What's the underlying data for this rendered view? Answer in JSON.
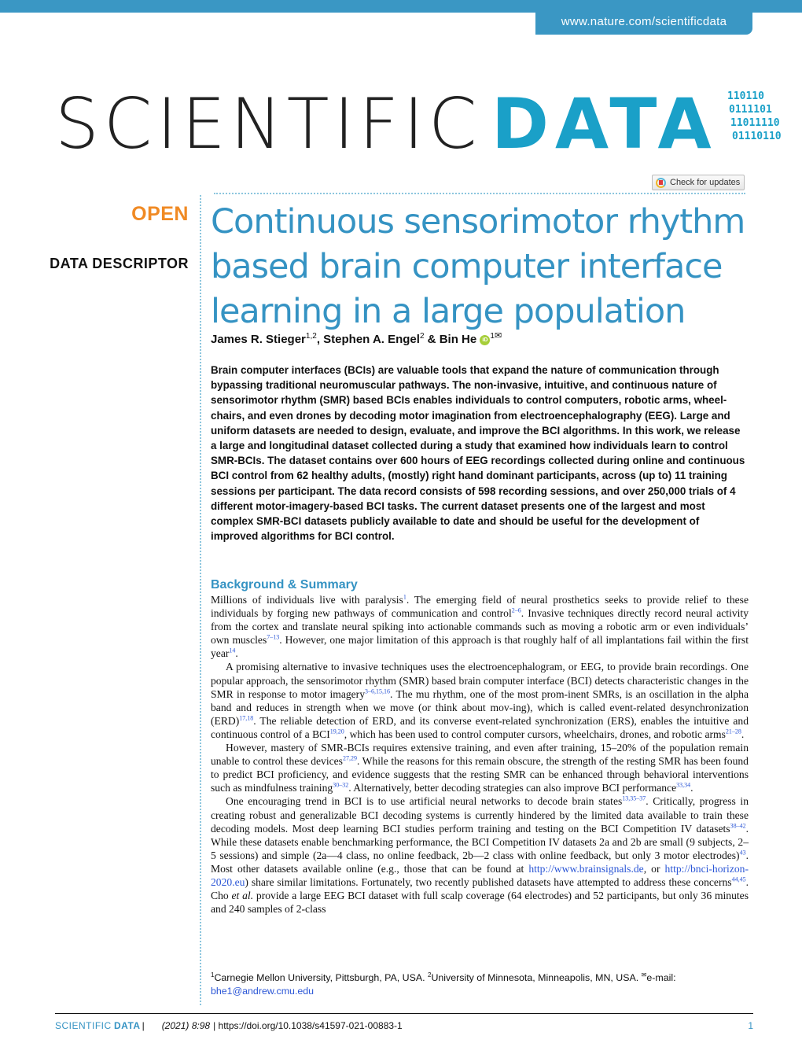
{
  "header": {
    "url": "www.nature.com/scientificdata"
  },
  "logo": {
    "word1": "SCIENTIFIC",
    "word2": "DATA",
    "binary": [
      "110110",
      "0111101",
      "11011110",
      "01110110"
    ]
  },
  "check_updates": {
    "label": "Check for updates",
    "icon": "crossmark-icon"
  },
  "badges": {
    "open": "OPEN",
    "type": "DATA DESCRIPTOR"
  },
  "colors": {
    "accent": "#3593c3",
    "open": "#f08a24",
    "link": "#2b56d6",
    "orcid": "#a6ce39"
  },
  "article": {
    "title": "Continuous sensorimotor rhythm based brain computer interface learning in a large population",
    "authors": [
      {
        "name": "James R. Stieger",
        "affil": "1,2"
      },
      {
        "name": "Stephen A. Engel",
        "affil": "2"
      },
      {
        "name": "Bin He",
        "affil": "1"
      }
    ],
    "author_sep1": ", ",
    "author_sep2": " & ",
    "orcid_label": "iD",
    "mail_symbol": "✉",
    "abstract": "Brain computer interfaces (BCIs) are valuable tools that expand the nature of communication through bypassing traditional neuromuscular pathways. The non-invasive, intuitive, and continuous nature of sensorimotor rhythm (SMR) based BCIs enables individuals to control computers, robotic arms, wheel-chairs, and even drones by decoding motor imagination from electroencephalography (EEG). Large and uniform datasets are needed to design, evaluate, and improve the BCI algorithms. In this work, we release a large and longitudinal dataset collected during a study that examined how individuals learn to control SMR-BCIs. The dataset contains over 600 hours of EEG recordings collected during online and continuous BCI control from 62 healthy adults, (mostly) right hand dominant participants, across (up to) 11 training sessions per participant. The data record consists of 598 recording sessions, and over 250,000 trials of 4 different motor-imagery-based BCI tasks. The current dataset presents one of the largest and most complex SMR-BCI datasets publicly available to date and should be useful for the development of improved algorithms for BCI control.",
    "section_heading": "Background & Summary",
    "paragraphs": [
      [
        {
          "t": "Millions of individuals live with paralysis"
        },
        {
          "r": "1"
        },
        {
          "t": ". The emerging field of neural prosthetics seeks to provide relief to these individuals by forging new pathways of communication and control"
        },
        {
          "r": "2–6"
        },
        {
          "t": ". Invasive techniques directly record neural activity from the cortex and translate neural spiking into actionable commands such as moving a robotic arm or even individuals’ own muscles"
        },
        {
          "r": "7–13"
        },
        {
          "t": ". However, one major limitation of this approach is that roughly half of all implantations fail within the first year"
        },
        {
          "r": "14"
        },
        {
          "t": "."
        }
      ],
      [
        {
          "t": "A promising alternative to invasive techniques uses the electroencephalogram, or EEG, to provide brain recordings. One popular approach, the sensorimotor rhythm (SMR) based brain computer interface (BCI) detects characteristic changes in the SMR in response to motor imagery"
        },
        {
          "r": "3–6,15,16"
        },
        {
          "t": ". The mu rhythm, one of the most prom-inent SMRs, is an oscillation in the alpha band and reduces in strength when we move (or think about mov-ing), which is called event-related desynchronization (ERD)"
        },
        {
          "r": "17,18"
        },
        {
          "t": ". The reliable detection of ERD, and its converse event-related synchronization (ERS), enables the intuitive and continuous control of a BCI"
        },
        {
          "r": "19,20"
        },
        {
          "t": ", which has been used to control computer cursors, wheelchairs, drones, and robotic arms"
        },
        {
          "r": "21–28"
        },
        {
          "t": "."
        }
      ],
      [
        {
          "t": "However, mastery of SMR-BCIs requires extensive training, and even after training, 15–20% of the population remain unable to control these devices"
        },
        {
          "r": "27,29"
        },
        {
          "t": ". While the reasons for this remain obscure, the strength of the resting SMR has been found to predict BCI proficiency, and evidence suggests that the resting SMR can be enhanced through behavioral interventions such as mindfulness training"
        },
        {
          "r": "30–32"
        },
        {
          "t": ". Alternatively, better decoding strategies can also improve BCI performance"
        },
        {
          "r": "33,34"
        },
        {
          "t": "."
        }
      ],
      [
        {
          "t": "One encouraging trend in BCI is to use artificial neural networks to decode brain states"
        },
        {
          "r": "13,35–37"
        },
        {
          "t": ". Critically, progress in creating robust and generalizable BCI decoding systems is currently hindered by the limited data available to train these decoding models. Most deep learning BCI studies perform training and testing on the BCI Competition IV datasets"
        },
        {
          "r": "38–42"
        },
        {
          "t": ". While these datasets enable benchmarking performance, the BCI Competition IV datasets 2a and 2b are small (9 subjects, 2–5 sessions) and simple (2a—4 class, no online feedback, 2b—2 class with online feedback, but only 3 motor electrodes)"
        },
        {
          "r": "43"
        },
        {
          "t": ". Most other datasets available online (e.g., those that can be found at "
        },
        {
          "l": "http://www.brainsignals.de"
        },
        {
          "t": ", or "
        },
        {
          "l": "http://bnci-horizon-2020.eu"
        },
        {
          "t": ") share similar limitations. Fortunately, two recently published datasets have attempted to address these concerns"
        },
        {
          "r": "44,45"
        },
        {
          "t": ". Cho "
        },
        {
          "i": "et al."
        },
        {
          "t": " provide a large EEG BCI dataset with full scalp coverage (64 electrodes) and 52 participants, but only 36 minutes and 240 samples of 2-class"
        }
      ]
    ],
    "affiliations": {
      "a1_num": "1",
      "a1": "Carnegie Mellon University, Pittsburgh, PA, USA. ",
      "a2_num": "2",
      "a2": "University of Minnesota, Minneapolis, MN, USA. ",
      "mail_symbol": "✉",
      "email_label": "e-mail: ",
      "email": "bhe1@andrew.cmu.edu"
    }
  },
  "footer": {
    "journal1": "SCIENTIFIC",
    "journal2": "DATA",
    "separator": "|",
    "citation": "(2021) 8:98",
    "doi": "| https://doi.org/10.1038/s41597-021-00883-1",
    "page": "1"
  }
}
